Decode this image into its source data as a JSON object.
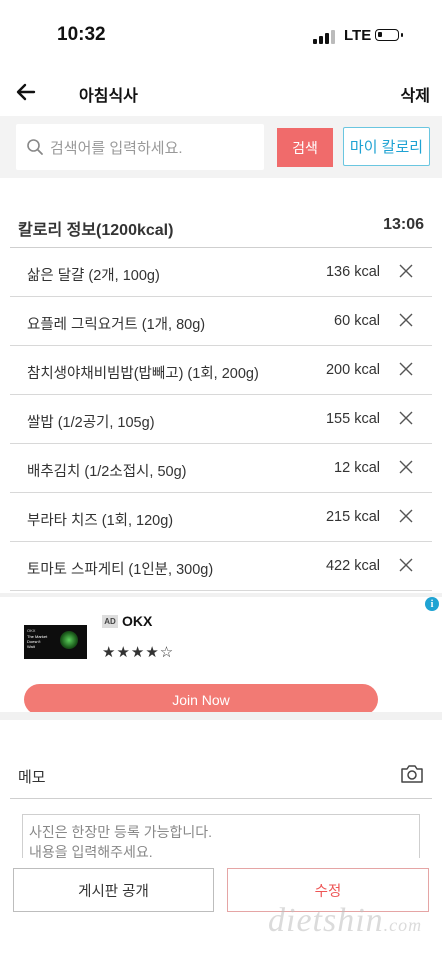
{
  "status": {
    "time": "10:32",
    "network": "LTE"
  },
  "header": {
    "title": "아침식사",
    "delete_label": "삭제"
  },
  "search": {
    "placeholder": "검색어를 입력하세요.",
    "button_label": "검색",
    "my_calorie_label": "마이 칼로리"
  },
  "calorie_info": {
    "label": "칼로리 정보(1200kcal)",
    "time": "13:06"
  },
  "foods": [
    {
      "name": "삶은 달걀 (2개, 100g)",
      "kcal": "136 kcal"
    },
    {
      "name": "요플레 그릭요거트 (1개, 80g)",
      "kcal": "60 kcal"
    },
    {
      "name": "참치생야채비빔밥(밥빼고) (1회, 200g)",
      "kcal": "200 kcal"
    },
    {
      "name": "쌀밥 (1/2공기, 105g)",
      "kcal": "155 kcal"
    },
    {
      "name": "배추김치 (1/2소접시, 50g)",
      "kcal": "12 kcal"
    },
    {
      "name": "부라타 치즈 (1회, 120g)",
      "kcal": "215 kcal"
    },
    {
      "name": "토마토 스파게티 (1인분, 300g)",
      "kcal": "422 kcal"
    }
  ],
  "ad": {
    "tag": "AD",
    "name": "OKX",
    "stars": "★★★★☆",
    "rating": 4,
    "cta": "Join Now",
    "image_brand": "OKX",
    "image_text": "The Market Doesn't Wait"
  },
  "memo": {
    "label": "메모",
    "placeholder_line1": "사진은 한장만 등록 가능합니다.",
    "placeholder_line2": "내용을 입력해주세요."
  },
  "bottom": {
    "public_label": "게시판 공개",
    "edit_label": "수정",
    "watermark": "dietshin",
    "watermark_suffix": ".com"
  },
  "colors": {
    "accent_red": "#f06b6b",
    "accent_blue": "#1fa3d3",
    "join_button": "#f27a74"
  },
  "icons": {
    "back": "arrow-left-icon",
    "search": "search-icon",
    "remove": "close-icon",
    "camera": "camera-icon",
    "ad_info": "info-icon"
  }
}
